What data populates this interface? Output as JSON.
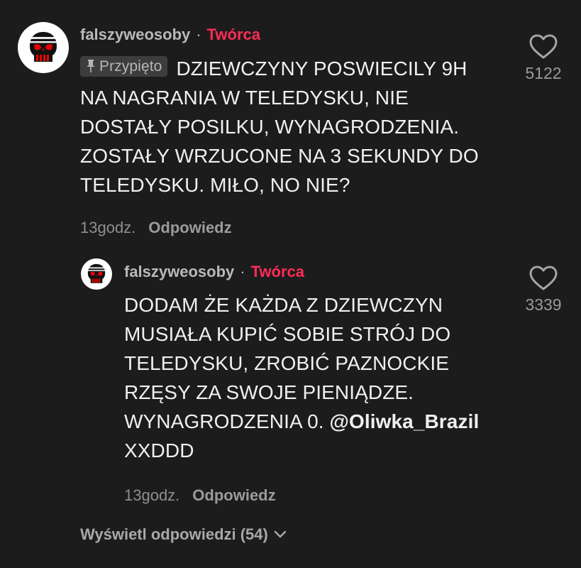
{
  "comment": {
    "username": "falszyweosoby",
    "separator": "·",
    "badge": "Twórca",
    "pinned_label": "Przypięto",
    "text": "DZIEWCZYNY POSWIECILY 9H NA NAGRANIA W TELEDYSKU, NIE DOSTAŁY POSILKU, WYNAGRODZENIA. ZOSTAŁY WRZUCONE NA 3 SEKUNDY DO TELEDYSKU. MIŁO, NO NIE?",
    "time": "13godz.",
    "reply_label": "Odpowiedz",
    "likes": "5122",
    "avatar_icon": "punisher-skull-icon"
  },
  "reply": {
    "username": "falszyweosoby",
    "separator": "·",
    "badge": "Twórca",
    "text": "DODAM ŻE KAŻDA Z DZIEWCZYN MUSIAŁA KUPIĆ SOBIE STRÓJ DO TELEDYSKU, ZROBIĆ PAZNOCKIE RZĘSY ZA SWOJE PIENIĄDZE. WYNAGRODZENIA 0.",
    "mention": "@Oliwka_Brazil",
    "text_after_mention": "XXDDD",
    "time": "13godz.",
    "reply_label": "Odpowiedz",
    "likes": "3339",
    "avatar_icon": "punisher-skull-icon"
  },
  "view_replies": {
    "label": "Wyświetl odpowiedzi (54)",
    "icon": "chevron-down-icon"
  },
  "colors": {
    "background": "#1c1c1c",
    "creator_badge": "#fe2c55",
    "text": "#f0f0f0",
    "muted": "#8f8f8f"
  }
}
